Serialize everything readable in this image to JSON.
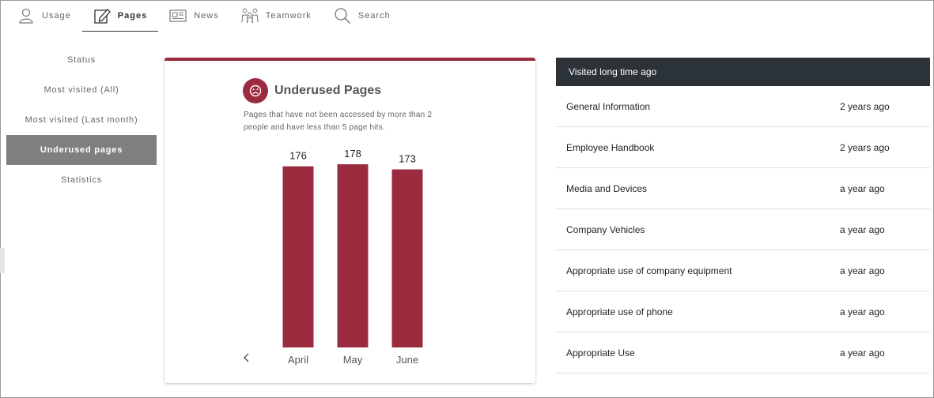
{
  "tabs": [
    {
      "label": "Usage",
      "icon": "person-icon",
      "active": false
    },
    {
      "label": "Pages",
      "icon": "edit-page-icon",
      "active": true
    },
    {
      "label": "News",
      "icon": "newspaper-icon",
      "active": false
    },
    {
      "label": "Teamwork",
      "icon": "team-icon",
      "active": false
    },
    {
      "label": "Search",
      "icon": "search-icon",
      "active": false
    }
  ],
  "sidenav": [
    {
      "label": "Status"
    },
    {
      "label": "Most visited (All)"
    },
    {
      "label": "Most visited (Last month)"
    },
    {
      "label": "Underused pages",
      "active": true
    },
    {
      "label": "Statistics"
    }
  ],
  "card": {
    "title": "Underused Pages",
    "description": "Pages that have not been accessed by more than 2 people and have less than 5 page hits."
  },
  "chart_data": {
    "type": "bar",
    "categories": [
      "April",
      "May",
      "June"
    ],
    "values": [
      176,
      178,
      173
    ],
    "title": "Underused Pages",
    "ylim": [
      0,
      178
    ],
    "grid": false,
    "color": "#9b2c40"
  },
  "table": {
    "header": "Visited long time ago",
    "rows": [
      {
        "title": "General Information",
        "time": "2 years ago"
      },
      {
        "title": "Employee Handbook",
        "time": "2 years ago"
      },
      {
        "title": "Media and Devices",
        "time": "a year ago"
      },
      {
        "title": "Company Vehicles",
        "time": "a year ago"
      },
      {
        "title": "Appropriate use of company equipment",
        "time": "a year ago"
      },
      {
        "title": "Appropriate use of phone",
        "time": "a year ago"
      },
      {
        "title": "Appropriate Use",
        "time": "a year ago"
      }
    ]
  },
  "colors": {
    "accent": "#9b2c40",
    "header_bg": "#2b3238",
    "nav_active": "#7f7f7f"
  }
}
